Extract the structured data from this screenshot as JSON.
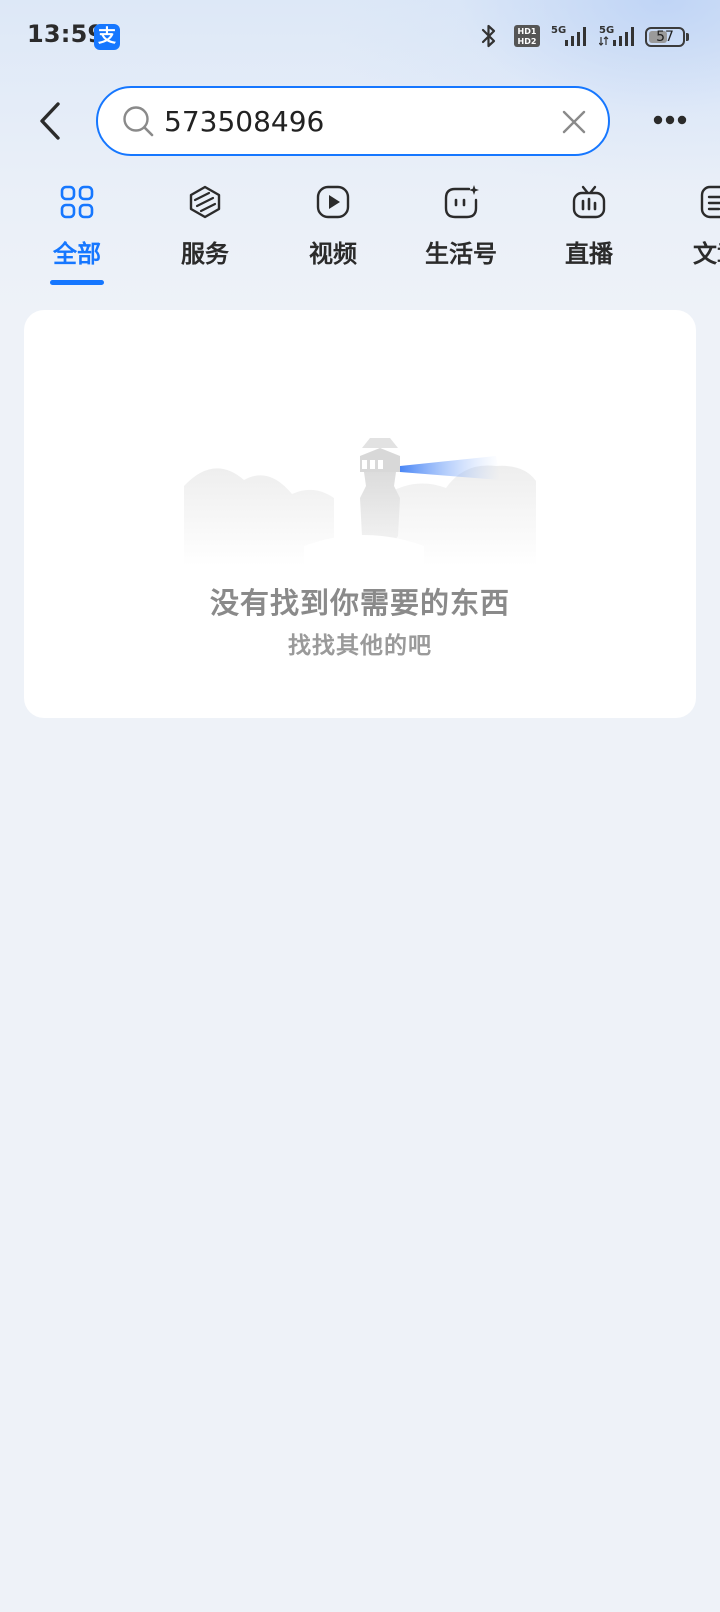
{
  "status_bar": {
    "time": "13:59",
    "app_badge": "支",
    "hd_label_top": "HD1",
    "hd_label_bottom": "HD2",
    "network_1": "5G",
    "network_2": "5G",
    "battery_level": "57",
    "battery_fraction": 0.57
  },
  "header": {
    "search": {
      "value": "573508496"
    }
  },
  "tabs": [
    {
      "label": "全部",
      "icon": "grid-icon",
      "active": true
    },
    {
      "label": "服务",
      "icon": "service-cube-icon",
      "active": false
    },
    {
      "label": "视频",
      "icon": "play-icon",
      "active": false
    },
    {
      "label": "生活号",
      "icon": "life-account-icon",
      "active": false
    },
    {
      "label": "直播",
      "icon": "tv-icon",
      "active": false
    },
    {
      "label": "文章",
      "icon": "article-icon",
      "active": false
    }
  ],
  "empty_state": {
    "title": "没有找到你需要的东西",
    "subtitle": "找找其他的吧"
  },
  "colors": {
    "accent": "#1677ff",
    "background": "#eef2f8",
    "card": "#ffffff",
    "empty_text": "#8a8a8a"
  }
}
